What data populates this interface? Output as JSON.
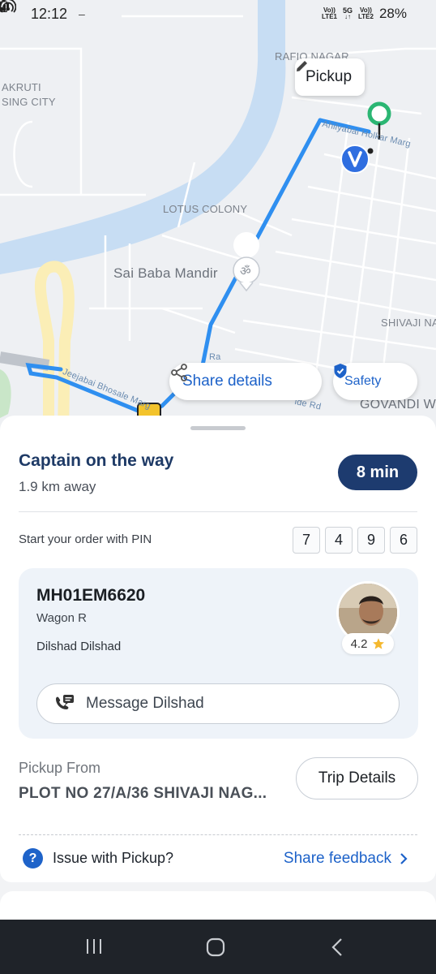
{
  "status_bar": {
    "time": "12:12",
    "dash": "–",
    "hotspot_icon": "hotspot-icon",
    "sim1_label_top": "Vo))",
    "sim1_label_bottom": "LTE1",
    "network_label_top": "5G",
    "network_label_bottom": "↓↑",
    "sim2_label_top": "Vo))",
    "sim2_label_bottom": "LTE2",
    "battery": "28%"
  },
  "map": {
    "labels": {
      "rafiq_nagar": "RAFIQ NAGAR",
      "akruti_1": "AKRUTI",
      "akruti_2": "SING CITY",
      "lotus_colony": "LOTUS COLONY",
      "sai_baba": "Sai Baba Mandir",
      "shivaji": "SHIVAJI NA",
      "govandi": "GOVANDI W",
      "road_ahilyabai": "Ahilyabai Holkar Marg",
      "road_jeejabai": "Jeejabai Bhosale Marg",
      "road_side": "ide Rd",
      "road_ra": "Ra"
    },
    "pickup_chip": {
      "label": "Pickup",
      "icon": "pencil-icon"
    },
    "share_details": {
      "label": "Share details",
      "icon": "share-icon"
    },
    "safety": {
      "label": "Safety",
      "icon": "shield-check-icon"
    }
  },
  "trip": {
    "status_title": "Captain on the way",
    "distance": "1.9 km away",
    "eta": "8 min",
    "pin_label": "Start your order with PIN",
    "pin": [
      "7",
      "4",
      "9",
      "6"
    ]
  },
  "driver": {
    "plate": "MH01EM6620",
    "car": "Wagon R",
    "name": "Dilshad Dilshad",
    "rating": "4.2",
    "rating_icon": "star-icon",
    "message_label": "Message Dilshad",
    "message_icon": "chat-phone-icon"
  },
  "pickup": {
    "label": "Pickup From",
    "address": "PLOT NO 27/A/36 SHIVAJI NAG...",
    "trip_details_label": "Trip Details"
  },
  "footer": {
    "issue_label": "Issue with Pickup?",
    "feedback_label": "Share feedback"
  },
  "colors": {
    "brand_blue": "#1d62c9",
    "navy": "#1d3b6f",
    "route": "#2f8ff0",
    "pickup_green": "#2bb673"
  }
}
